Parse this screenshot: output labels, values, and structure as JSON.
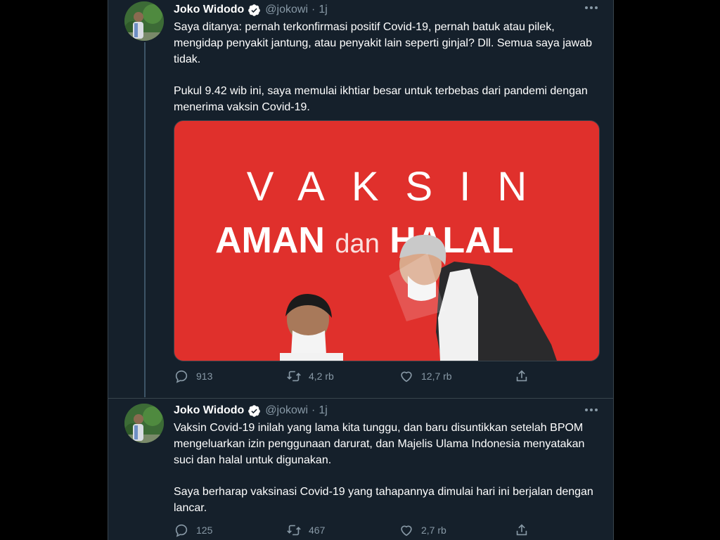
{
  "tweets": [
    {
      "author_name": "Joko Widodo",
      "handle": "@jokowi",
      "separator": "·",
      "time": "1j",
      "paragraphs": [
        "Saya ditanya: pernah terkonfirmasi positif Covid-19, pernah batuk atau pilek, mengidap penyakit jantung, atau penyakit lain seperti ginjal? Dll. Semua saya jawab tidak.",
        "Pukul 9.42 wib ini, saya memulai ikhtiar besar untuk terbebas dari pandemi dengan menerima vaksin Covid-19."
      ],
      "media": {
        "line1": "VAKSIN",
        "line2_a": "AMAN ",
        "line2_b": "dan",
        "line2_c": " HALAL"
      },
      "stats": {
        "replies": "913",
        "retweets": "4,2 rb",
        "likes": "12,7 rb"
      }
    },
    {
      "author_name": "Joko Widodo",
      "handle": "@jokowi",
      "separator": "·",
      "time": "1j",
      "paragraphs": [
        "Vaksin Covid-19 inilah yang lama kita tunggu, dan baru disuntikkan setelah BPOM mengeluarkan izin penggunaan darurat, dan Majelis Ulama Indonesia menyatakan suci dan halal untuk digunakan.",
        "Saya berharap vaksinasi Covid-19 yang tahapannya dimulai hari ini berjalan dengan lancar."
      ],
      "stats": {
        "replies": "125",
        "retweets": "467",
        "likes": "2,7 rb"
      }
    }
  ],
  "colors": {
    "background": "#15202b",
    "text_primary": "#ffffff",
    "text_secondary": "#8899a6",
    "verified_blue": "#1da1f2",
    "media_red": "#e0302c"
  },
  "icons": [
    "reply-icon",
    "retweet-icon",
    "like-icon",
    "share-icon",
    "more-icon",
    "verified-badge-icon"
  ]
}
